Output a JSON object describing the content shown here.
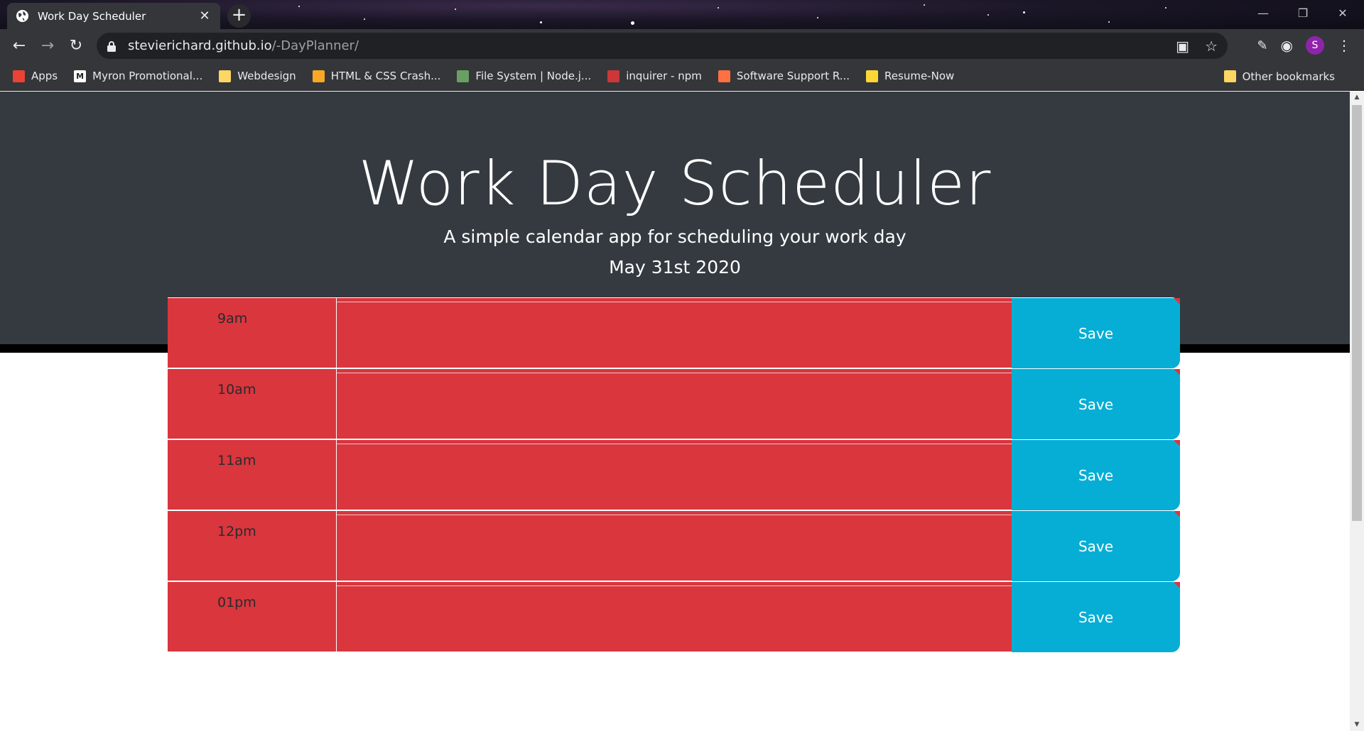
{
  "browser": {
    "tab_title": "Work Day Scheduler",
    "tab_close": "✕",
    "new_tab": "+",
    "url_host": "stevierichard.github.io",
    "url_path": "/-DayPlanner/",
    "profile_initial": "S"
  },
  "bookmarks": {
    "items": [
      {
        "label": "Apps",
        "icon": "apps-grid-icon",
        "color": "#ea4335"
      },
      {
        "label": "Myron Promotional...",
        "icon": "myron-icon",
        "color": "#ffffff"
      },
      {
        "label": "Webdesign",
        "icon": "folder-icon",
        "color": "#fdd663"
      },
      {
        "label": "HTML & CSS Crash...",
        "icon": "bars-icon",
        "color": "#f9a825"
      },
      {
        "label": "File System | Node.j...",
        "icon": "nodejs-icon",
        "color": "#68a063"
      },
      {
        "label": "inquirer - npm",
        "icon": "npm-icon",
        "color": "#cb3837"
      },
      {
        "label": "Software Support R...",
        "icon": "bars-icon",
        "color": "#ff7043"
      },
      {
        "label": "Resume-Now",
        "icon": "resume-icon",
        "color": "#fdd835"
      }
    ],
    "other": "Other bookmarks"
  },
  "header": {
    "title": "Work Day Scheduler",
    "lead": "A simple calendar app for scheduling your work day",
    "date": "May 31st 2020"
  },
  "planner": {
    "rows": [
      {
        "hour": "9am",
        "text": "",
        "save": "Save"
      },
      {
        "hour": "10am",
        "text": "",
        "save": "Save"
      },
      {
        "hour": "11am",
        "text": "",
        "save": "Save"
      },
      {
        "hour": "12pm",
        "text": "",
        "save": "Save"
      },
      {
        "hour": "01pm",
        "text": "",
        "save": "Save"
      }
    ]
  },
  "colors": {
    "past": "#d9363e",
    "save": "#06aed5",
    "jumbotron": "#343a40"
  }
}
